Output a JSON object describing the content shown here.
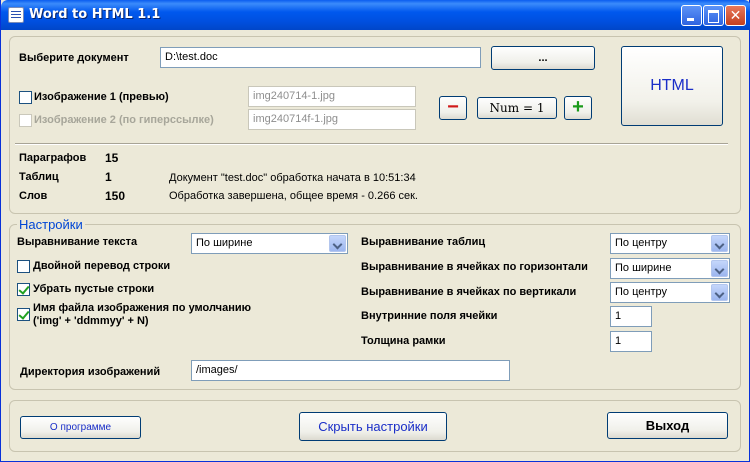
{
  "window": {
    "title": "Word to HTML 1.1"
  },
  "doc": {
    "label": "Выберите документ",
    "path": "D:\\test.doc",
    "browse_label": "...",
    "html_label": "HTML"
  },
  "images": {
    "img1_label": "Изображение 1 (превью)",
    "img1_value": "img240714-1.jpg",
    "img2_label": "Изображение 2 (по гиперссылке)",
    "img2_value": "img240714f-1.jpg",
    "minus_label": "−",
    "num_label": "Num = 1",
    "plus_label": "+"
  },
  "stats": {
    "paragraphs_label": "Параграфов",
    "paragraphs_value": "15",
    "tables_label": "Таблиц",
    "tables_value": "1",
    "words_label": "Слов",
    "words_value": "150",
    "log_line1": "Документ \"test.doc\" обработка начата в 10:51:34",
    "log_line2": "Обработка завершена, общее время - 0.266 сек."
  },
  "settings": {
    "legend": "Настройки",
    "text_align_label": "Выравнивание текста",
    "text_align_value": "По ширине",
    "double_break_label": "Двойной перевод строки",
    "remove_empty_label": "Убрать пустые строки",
    "default_img_name_line1": "Имя файла изображения по умолчанию",
    "default_img_name_line2": "('img' + 'ddmmyy' + N)",
    "table_align_label": "Выравнивание таблиц",
    "table_align_value": "По центру",
    "cell_halign_label": "Выравнивание в ячейках по горизонтали",
    "cell_halign_value": "По ширине",
    "cell_valign_label": "Выравнивание в ячейках по вертикали",
    "cell_valign_value": "По центру",
    "cell_padding_label": "Внутринние поля ячейки",
    "cell_padding_value": "1",
    "border_width_label": "Толщина рамки",
    "border_width_value": "1",
    "img_dir_label": "Директория изображений",
    "img_dir_value": "/images/"
  },
  "footer": {
    "about_label": "О программе",
    "hide_settings_label": "Скрыть настройки",
    "exit_label": "Выход"
  },
  "colors": {
    "accent": "#1a2ec8",
    "minus": "#d01818",
    "plus": "#1a9a1a"
  }
}
